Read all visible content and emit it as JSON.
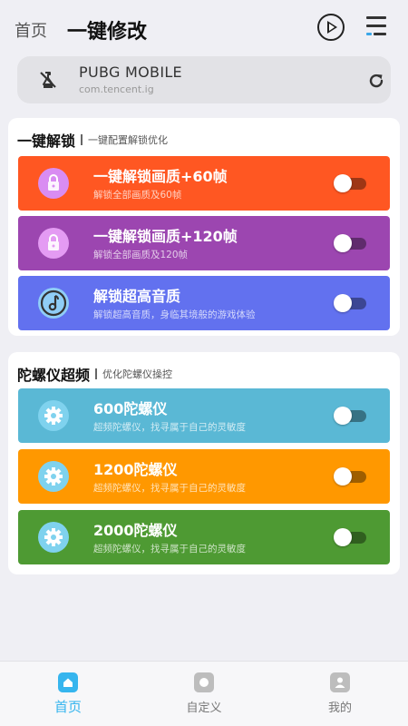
{
  "header": {
    "back_label": "首页",
    "title": "一键修改"
  },
  "app": {
    "name": "PUBG MOBILE",
    "package": "com.tencent.ig"
  },
  "sections": [
    {
      "title": "一键解锁",
      "subtitle": "一键配置解锁优化",
      "items": [
        {
          "title": "一键解锁画质+60帧",
          "subtitle": "解锁全部画质及60帧",
          "color": "#ff5722",
          "icon": "lock-icon",
          "on": false
        },
        {
          "title": "一键解锁画质+120帧",
          "subtitle": "解锁全部画质及120帧",
          "color": "#9c46b0",
          "icon": "lock-icon",
          "on": false
        },
        {
          "title": "解锁超高音质",
          "subtitle": "解锁超高音质，身临其境般的游戏体验",
          "color": "#6271ef",
          "icon": "music-icon",
          "on": false
        }
      ]
    },
    {
      "title": "陀螺仪超频",
      "subtitle": "优化陀螺仪操控",
      "items": [
        {
          "title": "600陀螺仪",
          "subtitle": "超频陀螺仪，找寻属于自己的灵敏度",
          "color": "#5ab8d5",
          "icon": "gear-icon",
          "on": false
        },
        {
          "title": "1200陀螺仪",
          "subtitle": "超频陀螺仪，找寻属于自己的灵敏度",
          "color": "#ff9800",
          "icon": "gear-icon",
          "on": false
        },
        {
          "title": "2000陀螺仪",
          "subtitle": "超频陀螺仪，找寻属于自己的灵敏度",
          "color": "#4e9a33",
          "icon": "gear-icon",
          "on": false
        }
      ]
    }
  ],
  "bottom_nav": [
    {
      "label": "首页",
      "icon": "home-icon",
      "active": true,
      "color": "#36b5ee"
    },
    {
      "label": "自定义",
      "icon": "custom-icon",
      "active": false,
      "color": "#bdbdbd"
    },
    {
      "label": "我的",
      "icon": "profile-icon",
      "active": false,
      "color": "#bdbdbd"
    }
  ]
}
